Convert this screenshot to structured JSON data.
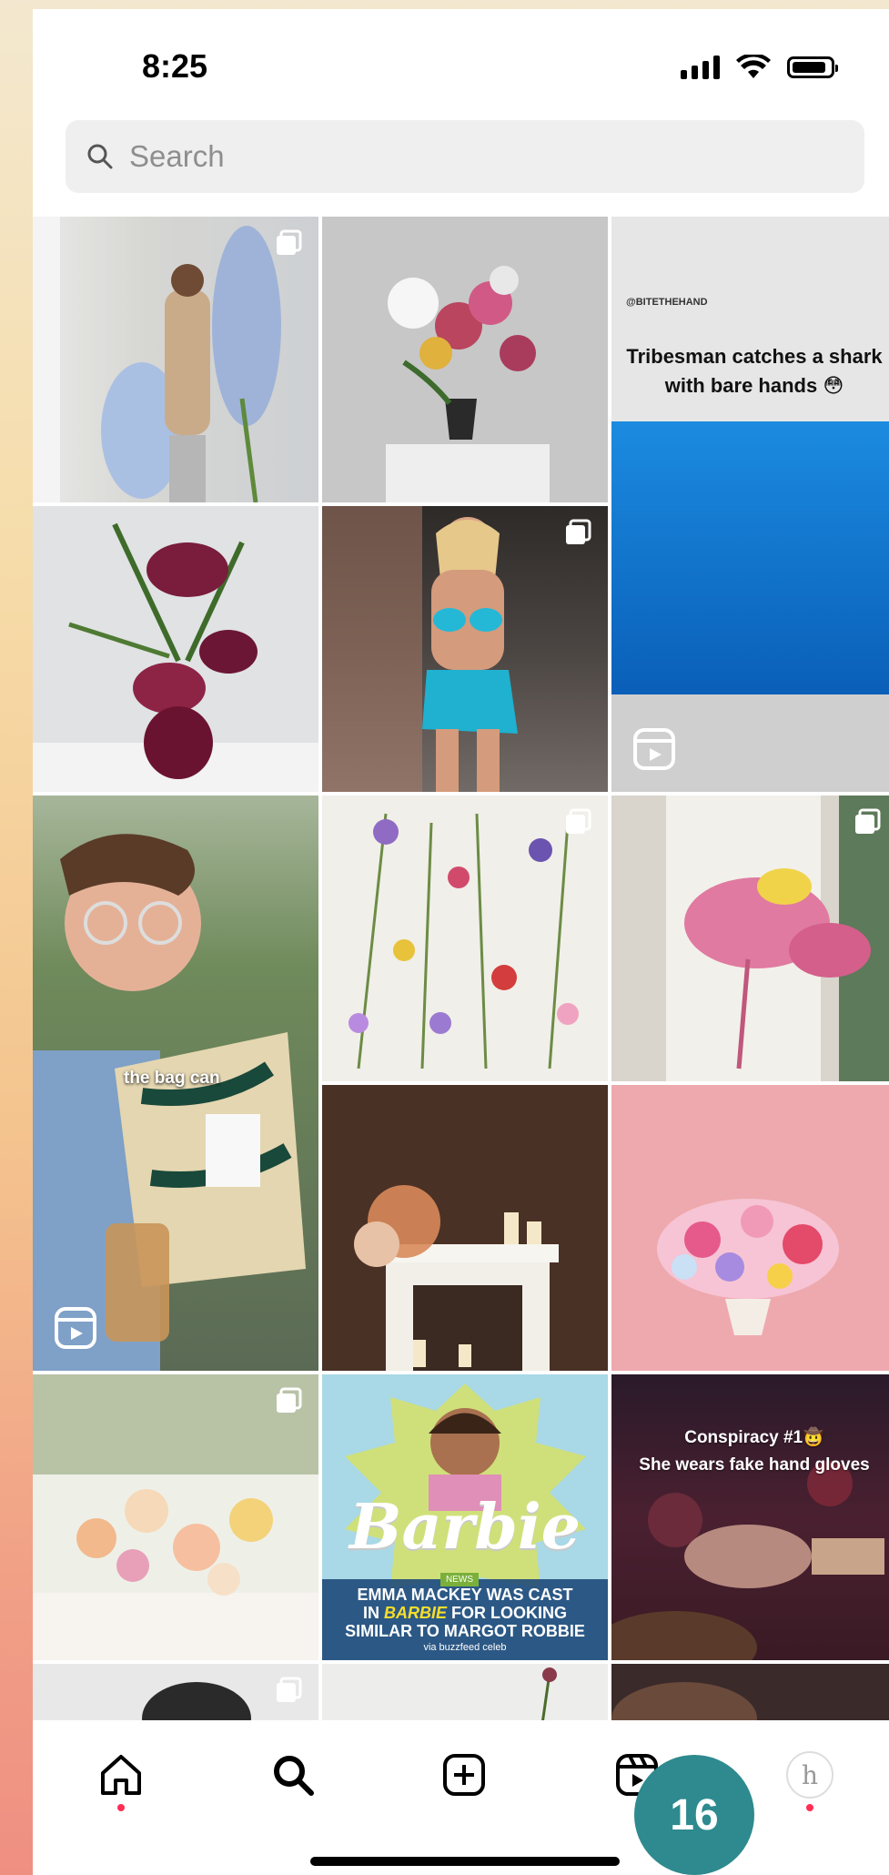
{
  "status_bar": {
    "time": "8:25",
    "icons": [
      "signal-icon",
      "wifi-icon",
      "battery-icon"
    ]
  },
  "search": {
    "placeholder": "Search",
    "icon": "search-icon"
  },
  "grid": {
    "tiles": [
      {
        "name": "florist-delphinium-post",
        "type": "carousel"
      },
      {
        "name": "lily-vase-arrangement-post",
        "type": "photo"
      },
      {
        "name": "shark-reel-post",
        "type": "reel",
        "handle": "@BITETHEHAND",
        "caption": "Tribesman catches a shark with bare hands 😳"
      },
      {
        "name": "anthurium-bouquet-post",
        "type": "photo"
      },
      {
        "name": "swimsuit-runway-post",
        "type": "carousel"
      },
      {
        "name": "starbucks-bag-reel-post",
        "type": "reel",
        "caption": "the bag can"
      },
      {
        "name": "pressed-flowers-post",
        "type": "carousel"
      },
      {
        "name": "bridal-bouquet-post",
        "type": "carousel"
      },
      {
        "name": "fireplace-flowers-post",
        "type": "photo"
      },
      {
        "name": "pink-bouquet-post",
        "type": "photo"
      },
      {
        "name": "peach-table-flowers-post",
        "type": "carousel"
      },
      {
        "name": "barbie-news-post",
        "type": "photo",
        "title": "Barbie",
        "badge": "NEWS",
        "headline_1": "EMMA MACKEY WAS CAST",
        "headline_2a": "IN ",
        "headline_2b": "BARBIE",
        "headline_2c": " FOR LOOKING",
        "headline_3": "SIMILAR TO MARGOT ROBBIE",
        "via": "via buzzfeed celeb"
      },
      {
        "name": "conspiracy-reel-post",
        "type": "reel",
        "caption_1": "Conspiracy #1🤠",
        "caption_2": "She wears fake hand gloves"
      }
    ]
  },
  "bottom_nav": {
    "items": [
      "home-icon",
      "search-icon",
      "create-icon",
      "reels-icon",
      "profile-avatar"
    ],
    "avatar_letter": "h"
  },
  "slide_badge": "16",
  "colors": {
    "accent_notification": "#ff2d55",
    "badge": "#2e8a8e"
  }
}
